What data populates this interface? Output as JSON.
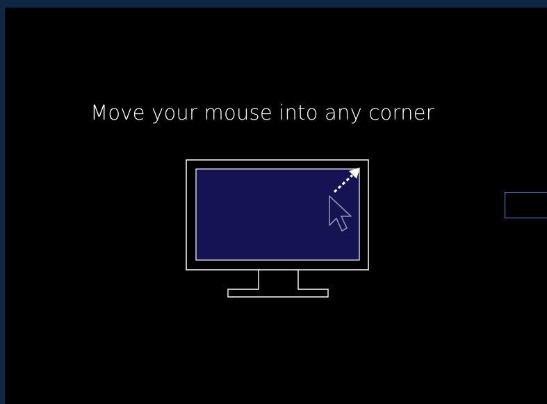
{
  "screen": {
    "instruction_text": "Move your mouse into any corner",
    "illustration": {
      "icon": "monitor-with-cursor-icon",
      "screen_color": "#151352",
      "arrow_direction": "top-right"
    },
    "colors": {
      "background": "#000000",
      "frame": "#0f2743",
      "text": "#ffffff",
      "accent": "#2f8fe0"
    }
  }
}
